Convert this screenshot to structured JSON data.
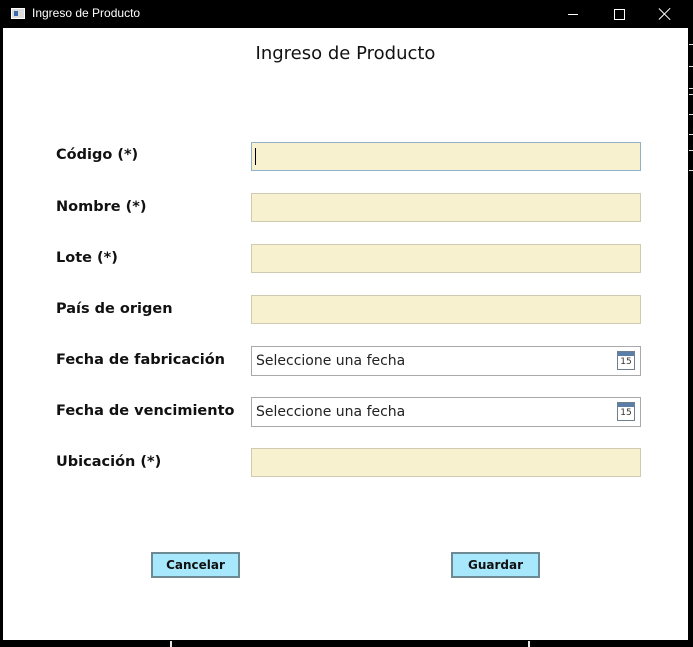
{
  "window": {
    "title": "Ingreso de Producto",
    "icon": "app-form-icon",
    "controls": [
      "minimize",
      "maximize",
      "close"
    ]
  },
  "form": {
    "heading": "Ingreso de Producto",
    "fields": {
      "codigo": {
        "label": "Código (*)",
        "value": ""
      },
      "nombre": {
        "label": "Nombre (*)",
        "value": ""
      },
      "lote": {
        "label": "Lote (*)",
        "value": ""
      },
      "pais": {
        "label": "País de origen",
        "value": ""
      },
      "fecha_fabricacion": {
        "label": "Fecha de fabricación",
        "placeholder": "Seleccione una fecha",
        "calendar_day": "15"
      },
      "fecha_vencimiento": {
        "label": "Fecha de vencimiento",
        "placeholder": "Seleccione una fecha",
        "calendar_day": "15"
      },
      "ubicacion": {
        "label": "Ubicación (*)",
        "value": ""
      }
    },
    "buttons": {
      "cancel": "Cancelar",
      "save": "Guardar"
    }
  },
  "colors": {
    "required_field_bg": "#f8f1cf",
    "button_bg": "#a8e8fc",
    "titlebar_bg": "#000000"
  }
}
